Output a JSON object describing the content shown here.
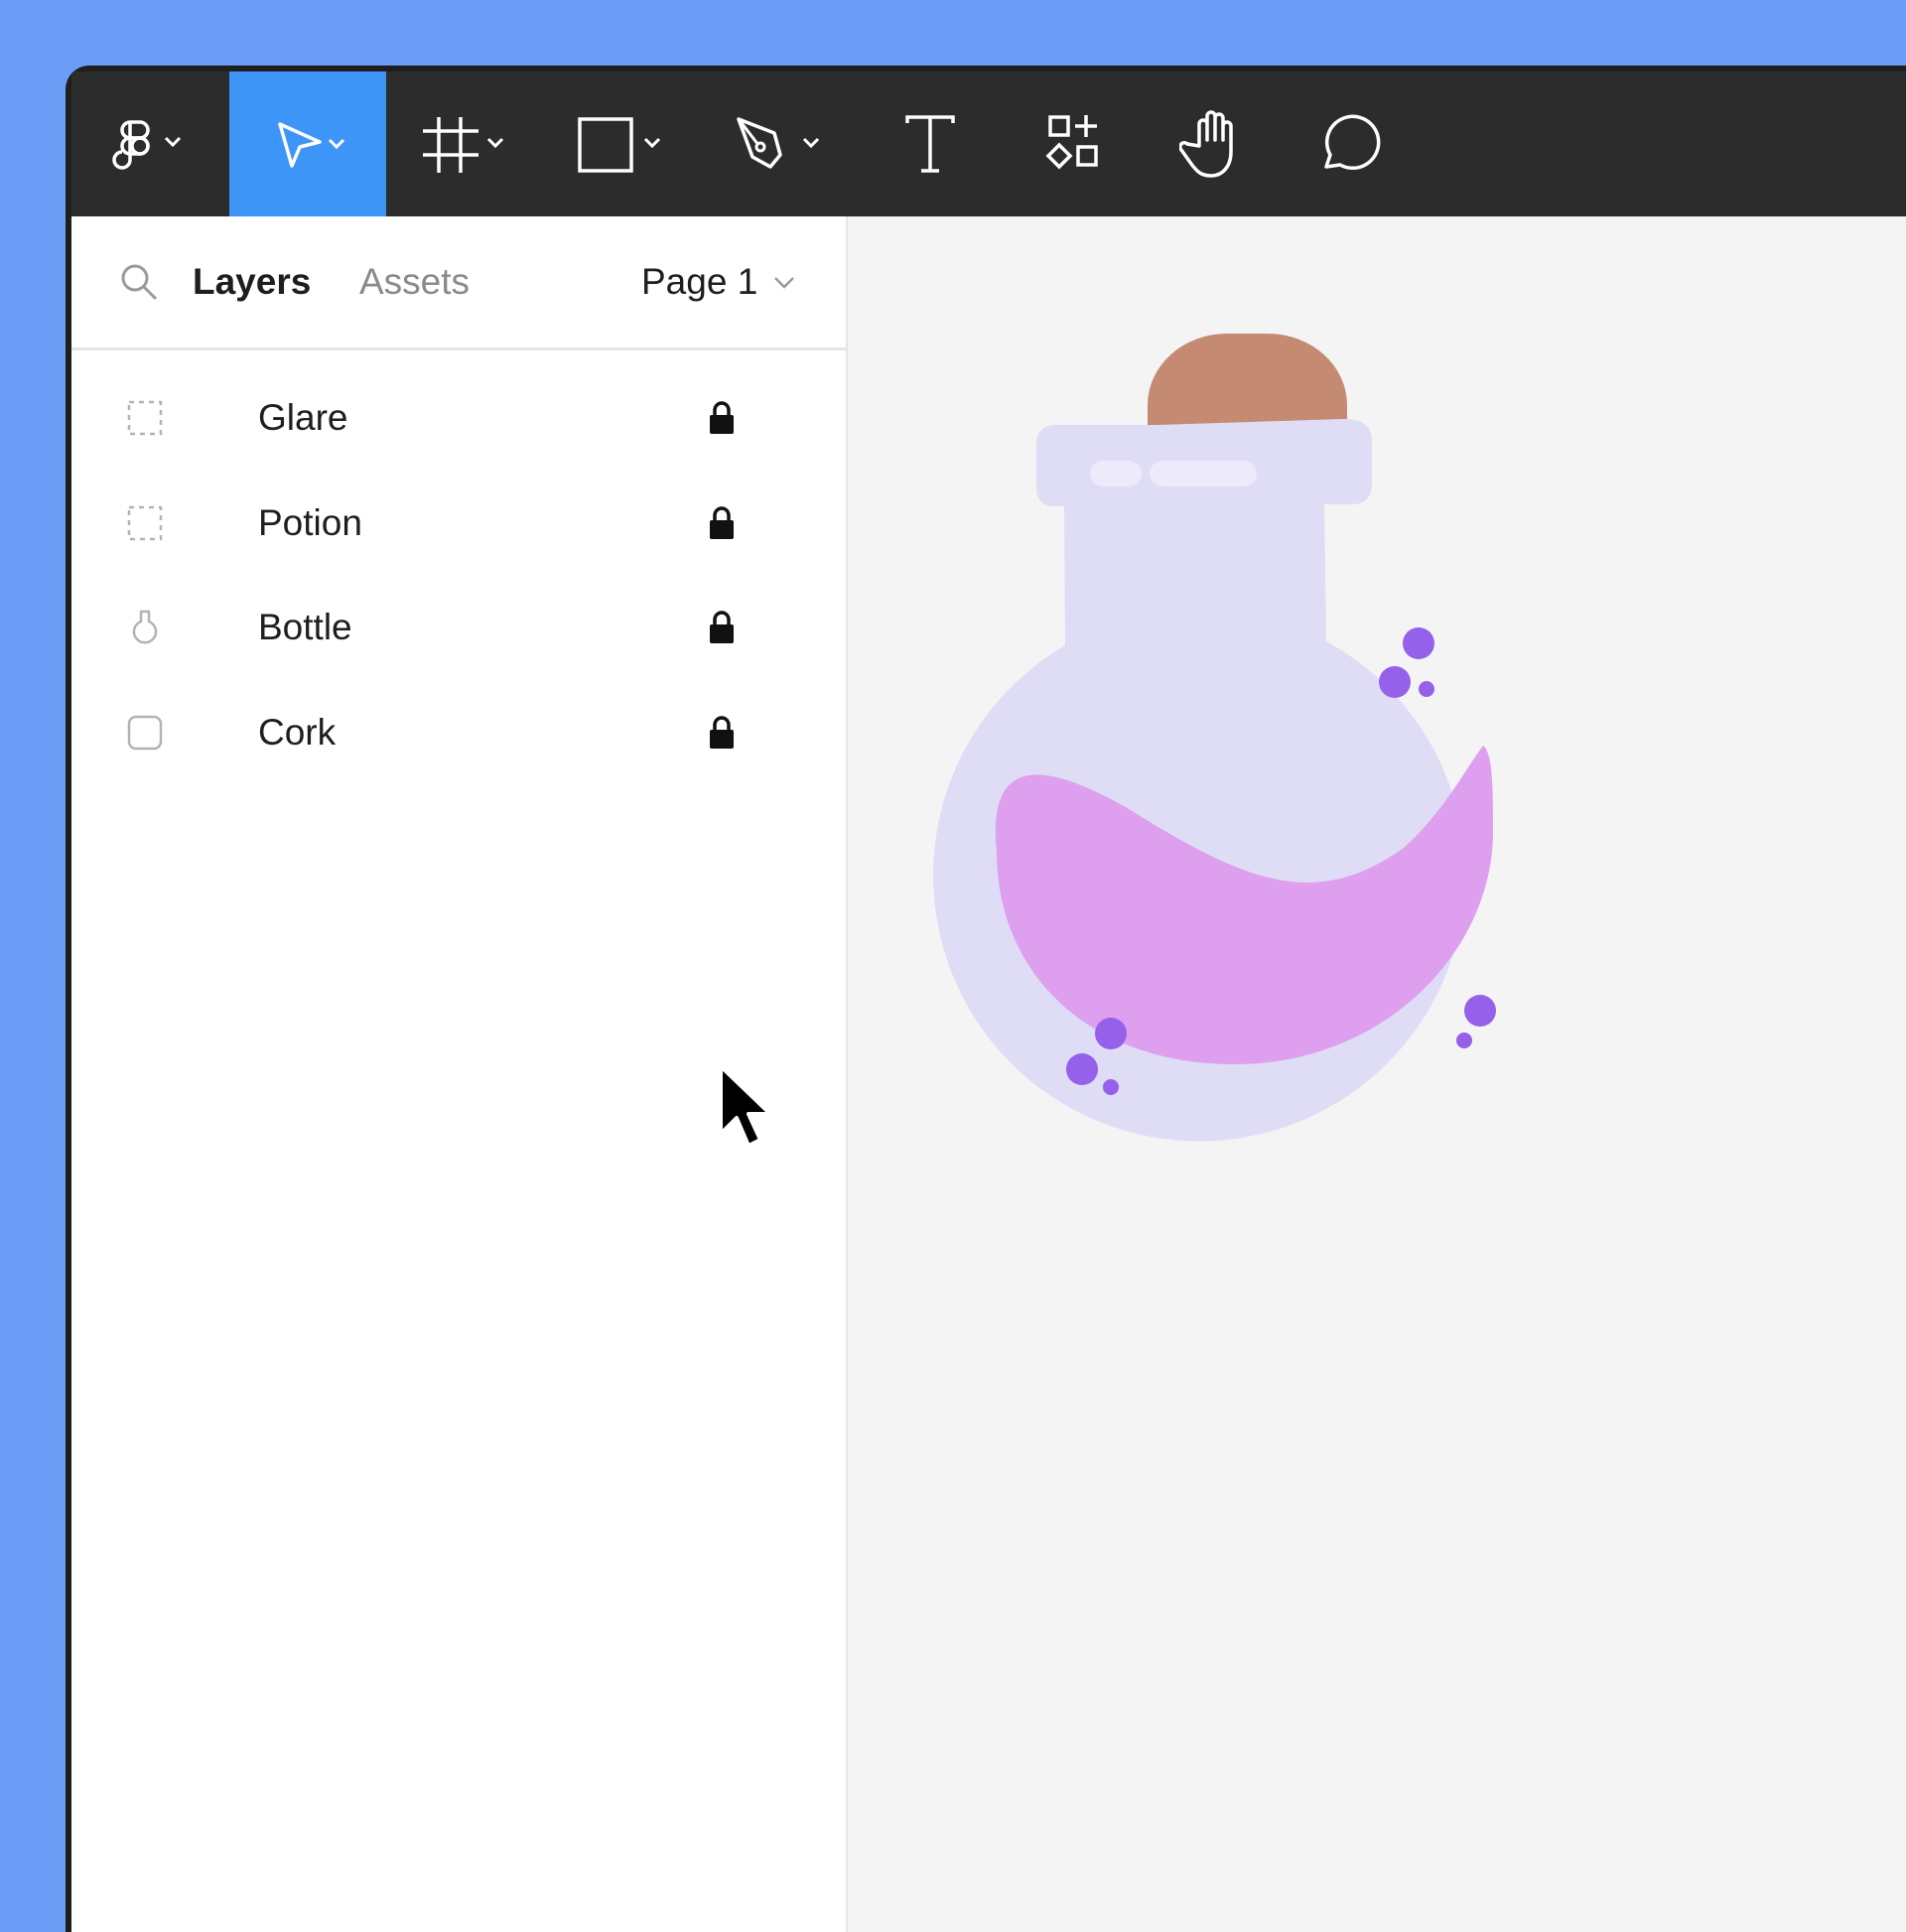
{
  "colors": {
    "background": "#6b9cf6",
    "toolbar": "#2c2c2c",
    "accent": "#3d96f7",
    "canvas": "#f4f4f4",
    "cork": "#c48a72",
    "bottle": "#dfdcf6",
    "potion": "#dd9fee",
    "bubbles": "#9560ea"
  },
  "toolbar": {
    "tools": [
      {
        "name": "main-menu",
        "icon": "figma-logo-icon",
        "has_dropdown": true,
        "active": false
      },
      {
        "name": "move",
        "icon": "move-arrow-icon",
        "has_dropdown": true,
        "active": true
      },
      {
        "name": "frame",
        "icon": "frame-icon",
        "has_dropdown": true,
        "active": false
      },
      {
        "name": "shape",
        "icon": "rectangle-icon",
        "has_dropdown": true,
        "active": false
      },
      {
        "name": "pen",
        "icon": "pen-icon",
        "has_dropdown": true,
        "active": false
      },
      {
        "name": "text",
        "icon": "text-icon",
        "has_dropdown": false,
        "active": false
      },
      {
        "name": "resources",
        "icon": "resources-icon",
        "has_dropdown": false,
        "active": false
      },
      {
        "name": "hand",
        "icon": "hand-icon",
        "has_dropdown": false,
        "active": false
      },
      {
        "name": "comment",
        "icon": "comment-icon",
        "has_dropdown": false,
        "active": false
      }
    ]
  },
  "panel": {
    "search_icon": "search-icon",
    "tabs": [
      {
        "label": "Layers",
        "active": true
      },
      {
        "label": "Assets",
        "active": false
      }
    ],
    "page_label": "Page 1"
  },
  "layers": [
    {
      "name": "Glare",
      "icon": "group-icon",
      "locked": true
    },
    {
      "name": "Potion",
      "icon": "group-icon",
      "locked": true
    },
    {
      "name": "Bottle",
      "icon": "vector-bottle-icon",
      "locked": true
    },
    {
      "name": "Cork",
      "icon": "rectangle-icon",
      "locked": true
    }
  ]
}
